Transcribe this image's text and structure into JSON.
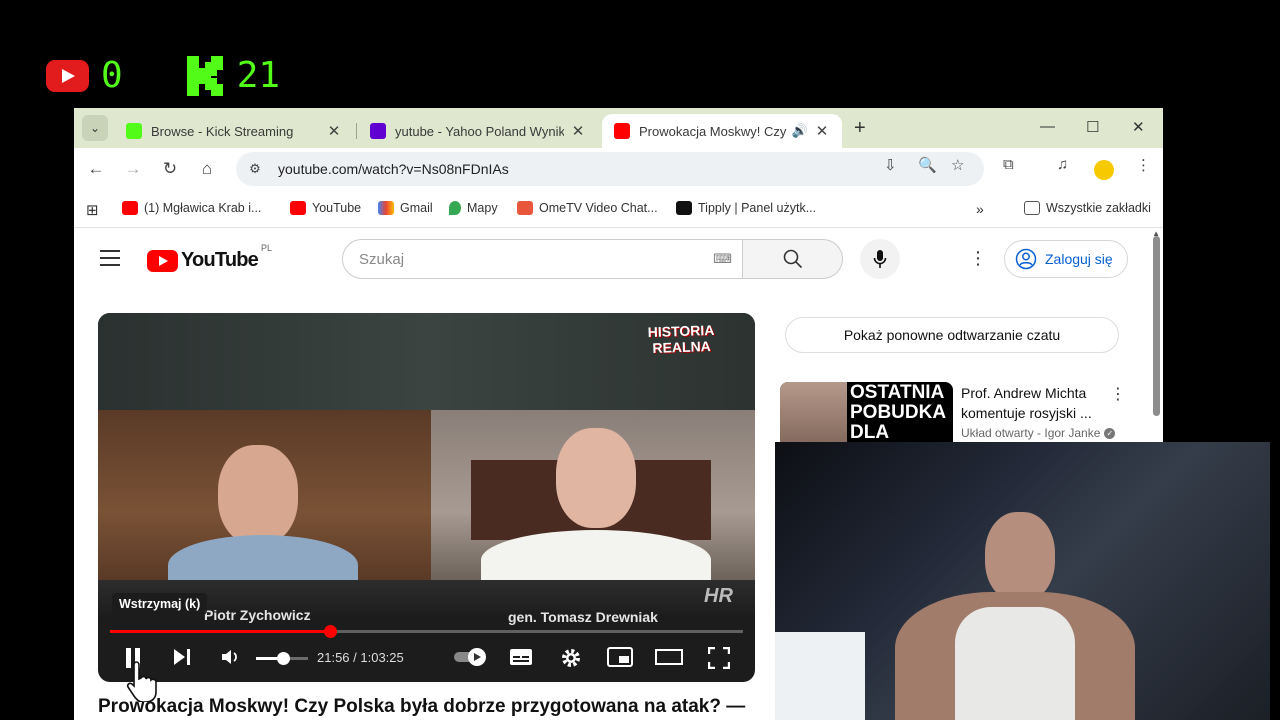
{
  "overlay": {
    "youtube_viewers": "0",
    "kick_viewers": "21"
  },
  "browser": {
    "tabs": [
      {
        "title": "Browse - Kick Streaming",
        "favicon": "kick-icon"
      },
      {
        "title": "yutube - Yahoo Poland Wyniki w",
        "favicon": "yahoo-icon"
      },
      {
        "title": "Prowokacja Moskwy! Czy Po",
        "favicon": "youtube-icon"
      }
    ],
    "url": "youtube.com/watch?v=Ns08nFDnIAs",
    "bookmarks": [
      {
        "label": "(1) Mgławica Krab i...",
        "icon": "youtube-icon"
      },
      {
        "label": "YouTube",
        "icon": "youtube-icon"
      },
      {
        "label": "Gmail",
        "icon": "gmail-icon"
      },
      {
        "label": "Mapy",
        "icon": "maps-icon"
      },
      {
        "label": "OmeTV Video Chat...",
        "icon": "ometv-icon"
      },
      {
        "label": "Tipply | Panel użytk...",
        "icon": "tipply-icon"
      }
    ],
    "all_bookmarks": "Wszystkie zakładki"
  },
  "youtube": {
    "region": "PL",
    "search_placeholder": "Szukaj",
    "sign_in": "Zaloguj się",
    "video": {
      "channel_logo_line1": "HISTORIA",
      "channel_logo_line2": "REALNA",
      "speaker_left": "Piotr Zychowicz",
      "speaker_right": "gen. Tomasz Drewniak",
      "tooltip": "Wstrzymaj (k)",
      "time_current": "21:56",
      "time_total": "1:03:25",
      "time_display": "21:56 / 1:03:25",
      "progress": 0.348,
      "volume": 0.52,
      "title": "Prowokacja Moskwy! Czy Polska była dobrze przygotowana na atak? —"
    },
    "chat_replay": "Pokaż ponowne odtwarzanie czatu",
    "recommended": {
      "thumb_text_1": "OSTATNIA",
      "thumb_text_2": "POBUDKA",
      "thumb_text_3": "DLA POLSKI",
      "title": "Prof. Andrew Michta komentuje rosyjski ...",
      "channel": "Układ otwarty - Igor Janke"
    }
  },
  "colors": {
    "kick_green": "#53fc18",
    "youtube_red": "#ff0000",
    "tab_strip": "#dfe7cf",
    "link_blue": "#065fd4"
  }
}
